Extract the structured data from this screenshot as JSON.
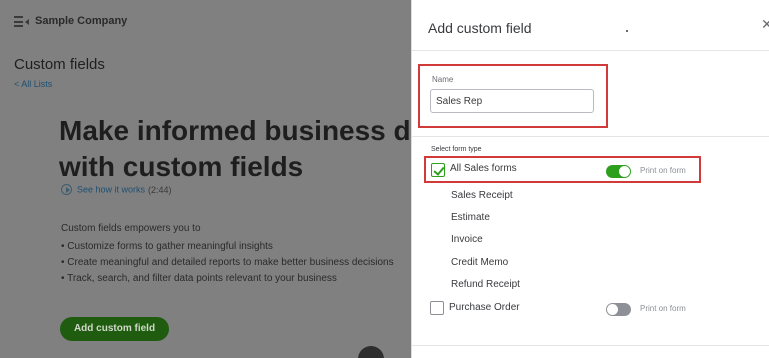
{
  "background": {
    "company_name": "Sample Company",
    "page_title": "Custom fields",
    "back_link": "< All Lists",
    "hero_line1": "Make informed business decisions",
    "hero_line2": "with custom fields",
    "video_link": "See how it works",
    "video_duration": "(2:44)",
    "intro": "Custom fields empowers you to",
    "bullets": [
      "Customize forms to gather meaningful insights",
      "Create meaningful and detailed reports to make better business decisions",
      "Track, search, and filter data points relevant to your business"
    ],
    "add_button": "Add custom field"
  },
  "panel": {
    "title": "Add custom field",
    "close_icon": "close-icon",
    "name_label": "Name",
    "name_value": "Sales Rep",
    "form_type_label": "Select form type",
    "sales_forms": {
      "label": "All Sales forms",
      "checked": true,
      "print_on_form": true,
      "print_label": "Print on form"
    },
    "sub_forms": [
      "Sales Receipt",
      "Estimate",
      "Invoice",
      "Credit Memo",
      "Refund Receipt"
    ],
    "purchase_order": {
      "label": "Purchase Order",
      "checked": false,
      "print_on_form": false,
      "print_label": "Print on form"
    }
  },
  "colors": {
    "highlight": "#d23a3a",
    "brand_green": "#2ca01c",
    "dim_overlay": "#808080"
  }
}
